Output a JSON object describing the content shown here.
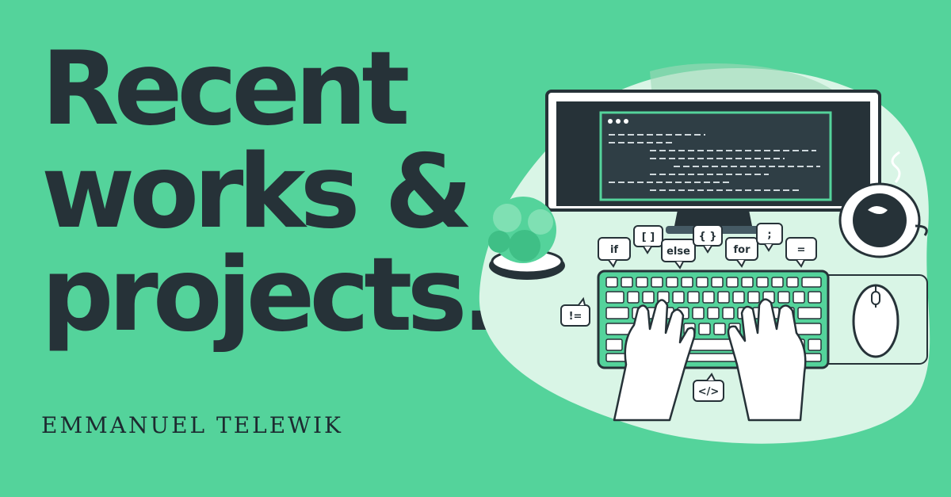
{
  "headline": {
    "line1": "Recent",
    "line2": "works &",
    "line3": "projects."
  },
  "author": "EMMANUEL TELEWIK",
  "code_tokens": [
    "if",
    "[ ]",
    "else",
    "{ }",
    "for",
    ";",
    "=",
    "!=",
    "</>"
  ],
  "colors": {
    "background": "#54d39b",
    "text": "#263238",
    "accent_light": "#d9f5e6",
    "accent_dark": "#263238"
  }
}
